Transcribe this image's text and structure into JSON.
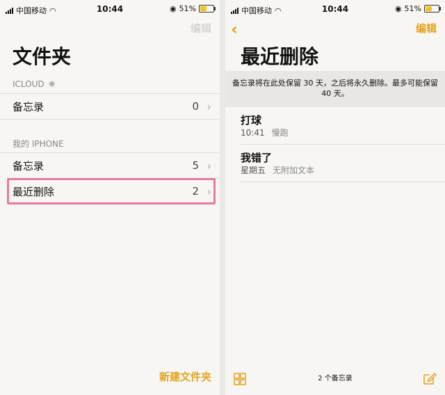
{
  "status_left": {
    "carrier": "中国移动",
    "time": "10:44",
    "battery": "51%",
    "battery_level": 0.51
  },
  "status_right": {
    "carrier": "中国移动",
    "time": "10:44",
    "battery": "51%",
    "battery_level": 0.51
  },
  "folders": {
    "edit_label": "编辑",
    "title": "文件夹",
    "icloud_header": "ICLOUD",
    "icloud_items": [
      {
        "label": "备忘录",
        "count": "0"
      }
    ],
    "iphone_header": "我的 IPHONE",
    "iphone_items": [
      {
        "label": "备忘录",
        "count": "5"
      },
      {
        "label": "最近删除",
        "count": "2"
      }
    ],
    "new_folder_label": "新建文件夹"
  },
  "recently_deleted": {
    "edit_label": "编辑",
    "title": "最近删除",
    "banner": "备忘录将在此处保留 30 天，之后将永久删除。最多可能保留 40 天。",
    "notes": [
      {
        "title": "打球",
        "time": "10:41",
        "preview": "慢跑"
      },
      {
        "title": "我错了",
        "time": "星期五",
        "preview": "无附加文本"
      }
    ],
    "count_label": "2 个备忘录"
  },
  "colors": {
    "accent": "#e4a421",
    "highlight": "#e77aa5"
  }
}
